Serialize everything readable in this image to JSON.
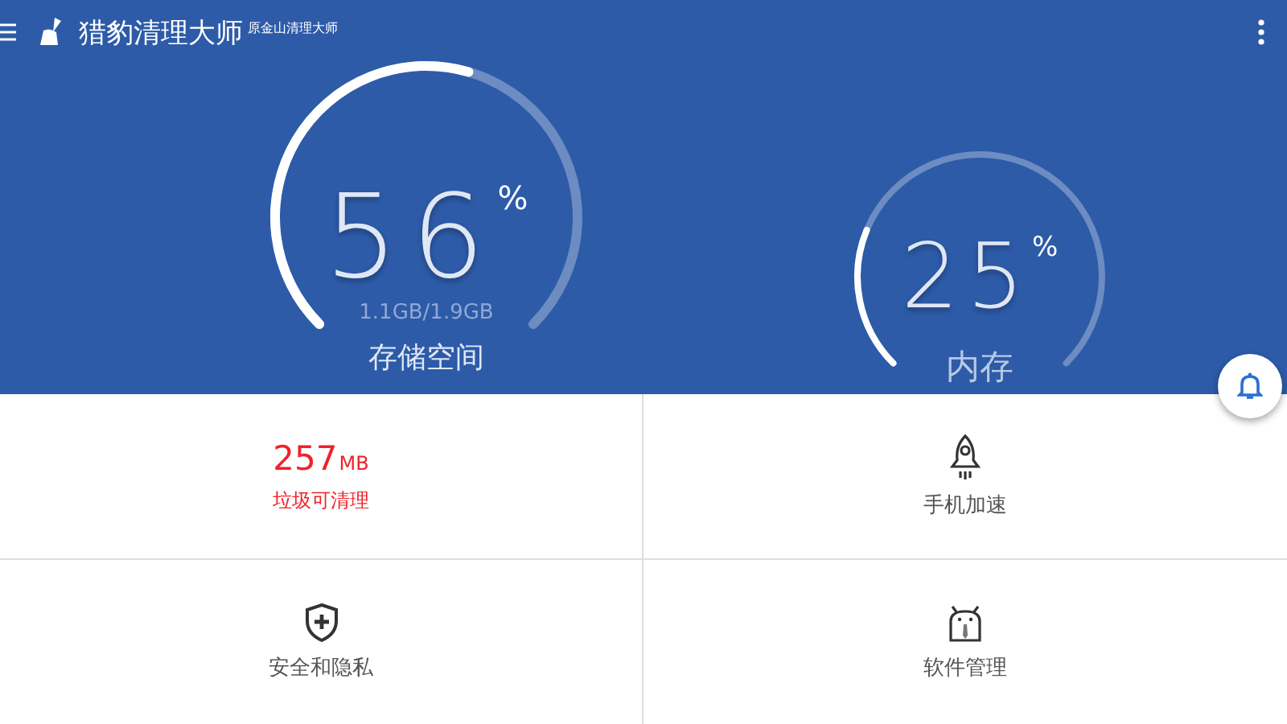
{
  "app_bar": {
    "title": "猎豹清理大师",
    "subtitle": "原金山清理大师"
  },
  "gauges": [
    {
      "value": "56",
      "unit": "%",
      "detail": "1.1GB/1.9GB",
      "label": "存储空间"
    },
    {
      "value": "25",
      "unit": "%",
      "label": "内存"
    }
  ],
  "tiles": [
    {
      "kind": "junk",
      "amount": "257",
      "unit": "MB",
      "label": "垃圾可清理"
    },
    {
      "kind": "boost",
      "label": "手机加速"
    },
    {
      "kind": "security",
      "label": "安全和隐私"
    },
    {
      "kind": "apps",
      "label": "软件管理"
    }
  ]
}
